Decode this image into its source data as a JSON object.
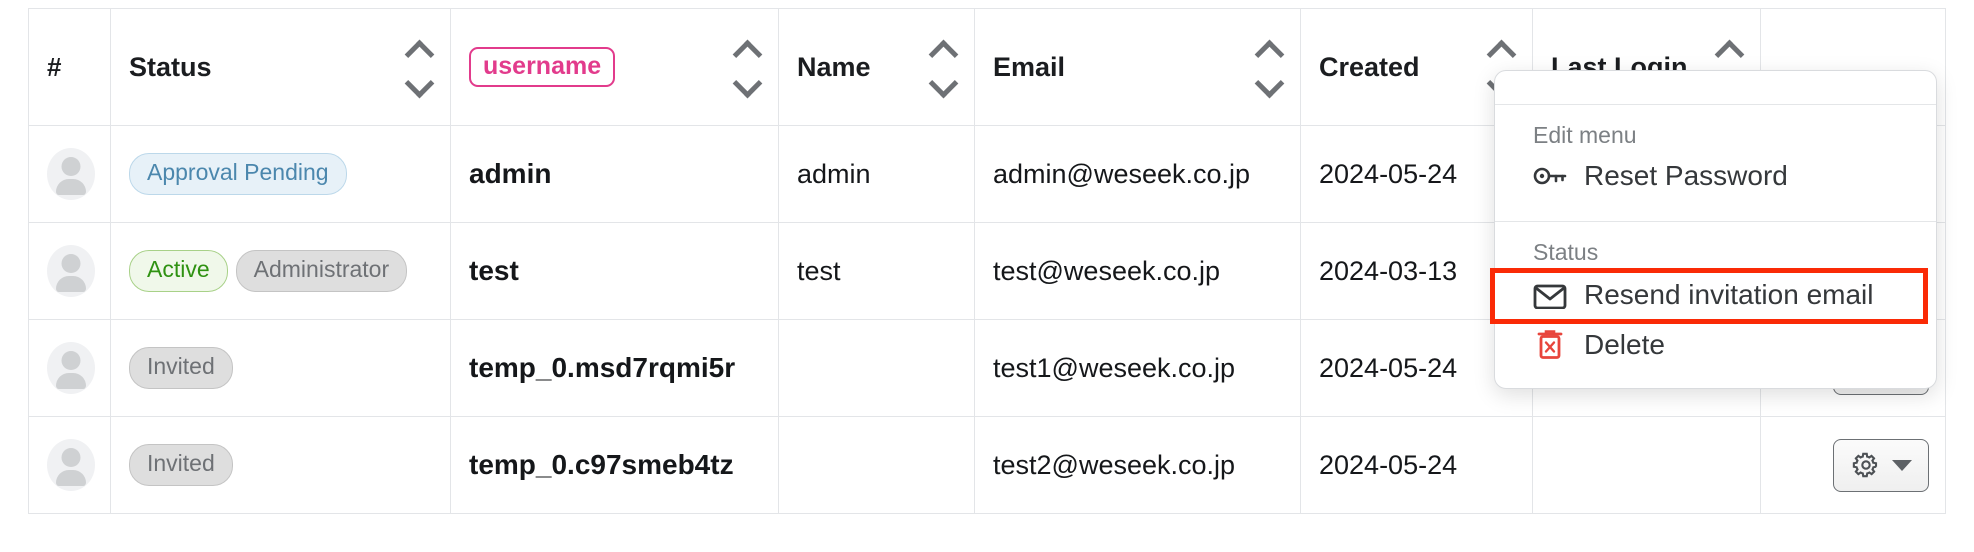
{
  "table": {
    "columns": [
      {
        "key": "num",
        "label": "#",
        "sortable": false,
        "style": "plain"
      },
      {
        "key": "status",
        "label": "Status",
        "sortable": true,
        "style": "plain"
      },
      {
        "key": "username",
        "label": "username",
        "sortable": true,
        "style": "badge"
      },
      {
        "key": "name",
        "label": "Name",
        "sortable": true,
        "style": "plain"
      },
      {
        "key": "email",
        "label": "Email",
        "sortable": true,
        "style": "plain"
      },
      {
        "key": "created",
        "label": "Created",
        "sortable": true,
        "style": "plain"
      },
      {
        "key": "lastlogin",
        "label": "Last Login",
        "sortable": true,
        "style": "plain"
      },
      {
        "key": "actions",
        "label": "",
        "sortable": false,
        "style": "plain"
      }
    ],
    "rows": [
      {
        "avatar": "user-avatar-placeholder",
        "badges": [
          {
            "text": "Approval Pending",
            "variant": "approval"
          }
        ],
        "username": "admin",
        "name": "admin",
        "email": "admin@weseek.co.jp",
        "created": "2024-05-24",
        "lastlogin": "",
        "action_label": "gear-dropdown"
      },
      {
        "avatar": "user-avatar-placeholder",
        "badges": [
          {
            "text": "Active",
            "variant": "active"
          },
          {
            "text": "Administrator",
            "variant": "admin"
          }
        ],
        "username": "test",
        "name": "test",
        "email": "test@weseek.co.jp",
        "created": "2024-03-13",
        "lastlogin": "",
        "action_label": "gear-dropdown"
      },
      {
        "avatar": "user-avatar-placeholder",
        "badges": [
          {
            "text": "Invited",
            "variant": "invited"
          }
        ],
        "username": "temp_0.msd7rqmi5r",
        "name": "",
        "email": "test1@weseek.co.jp",
        "created": "2024-05-24",
        "lastlogin": "",
        "action_label": "gear-dropdown"
      },
      {
        "avatar": "user-avatar-placeholder",
        "badges": [
          {
            "text": "Invited",
            "variant": "invited"
          }
        ],
        "username": "temp_0.c97smeb4tz",
        "name": "",
        "email": "test2@weseek.co.jp",
        "created": "2024-05-24",
        "lastlogin": "",
        "action_label": "gear-dropdown"
      }
    ]
  },
  "dropdown": {
    "open": true,
    "sections": [
      {
        "label": "Edit menu",
        "items": [
          {
            "icon": "key-icon",
            "label": "Reset Password",
            "highlighted": false,
            "danger": false
          }
        ]
      },
      {
        "label": "Status",
        "items": [
          {
            "icon": "envelope-icon",
            "label": "Resend invitation email",
            "highlighted": true,
            "danger": false
          },
          {
            "icon": "trash-x-icon",
            "label": "Delete",
            "highlighted": false,
            "danger": true
          }
        ]
      }
    ]
  },
  "colors": {
    "highlight_box": "#FA2A06",
    "username_badge": "#E23B8C",
    "approval_pending_text": "#4B87AD",
    "active_text": "#2F9212",
    "muted_text": "#6E7175",
    "danger": "#E8453C"
  }
}
